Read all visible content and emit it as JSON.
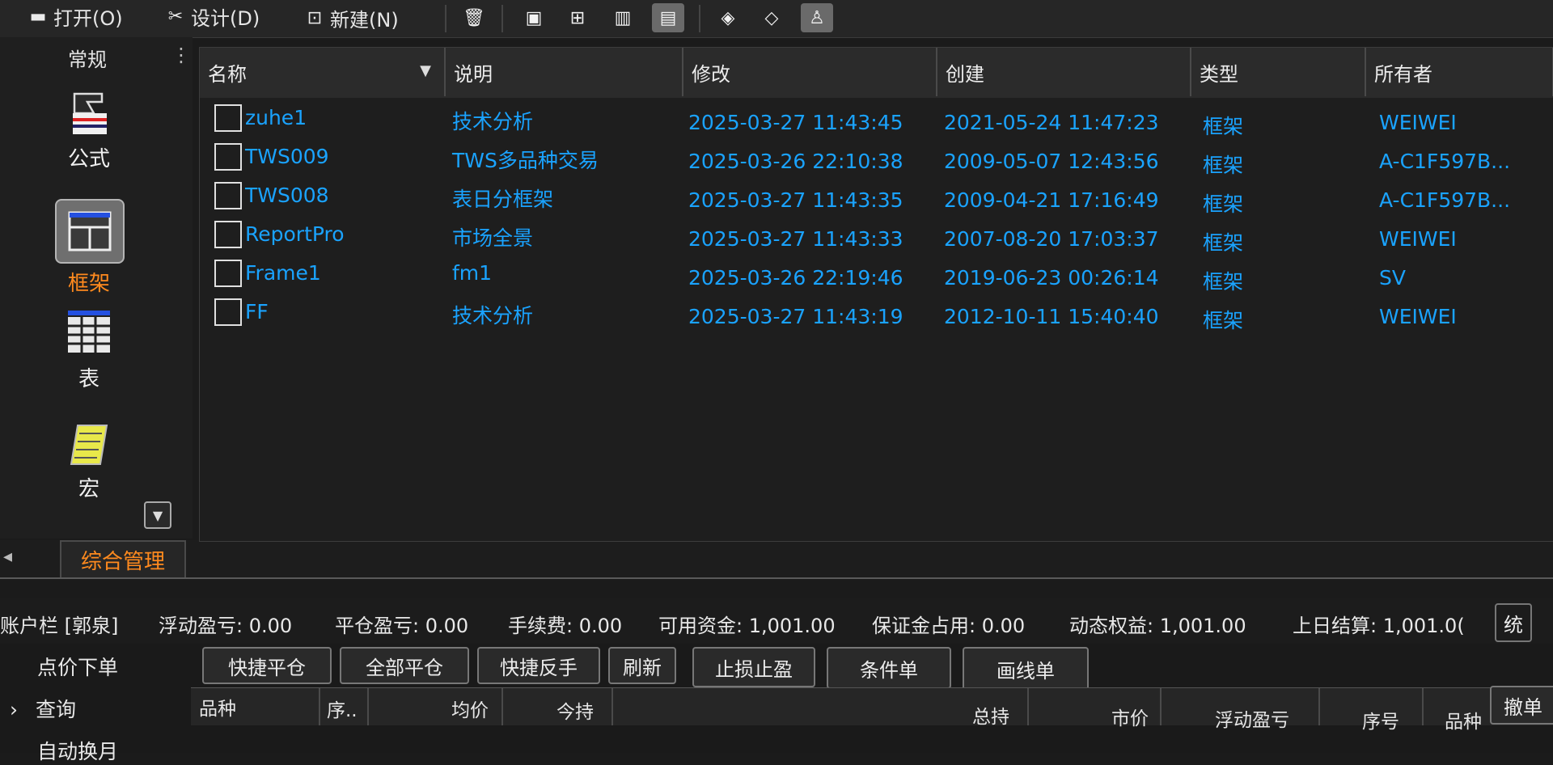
{
  "toolbar": {
    "open_label": "打开(O)",
    "design_label": "设计(D)",
    "new_label": "新建(N)"
  },
  "leftnav": {
    "title": "常规",
    "items": [
      {
        "label": "公式",
        "icon": "formula-icon"
      },
      {
        "label": "框架",
        "icon": "frame-icon",
        "selected": true
      },
      {
        "label": "表",
        "icon": "table-icon"
      },
      {
        "label": "宏",
        "icon": "macro-icon"
      }
    ]
  },
  "tabs": {
    "active": "综合管理"
  },
  "table": {
    "columns": [
      "名称",
      "说明",
      "修改",
      "创建",
      "类型",
      "所有者"
    ],
    "rows": [
      {
        "name": "zuhe1",
        "desc": "技术分析",
        "modified": "2025-03-27 11:43:45",
        "created": "2021-05-24 11:47:23",
        "type": "框架",
        "owner": "WEIWEI"
      },
      {
        "name": "TWS009",
        "desc": "TWS多品种交易",
        "modified": "2025-03-26 22:10:38",
        "created": "2009-05-07 12:43:56",
        "type": "框架",
        "owner": "A-C1F597B..."
      },
      {
        "name": "TWS008",
        "desc": "表日分框架",
        "modified": "2025-03-27 11:43:35",
        "created": "2009-04-21 17:16:49",
        "type": "框架",
        "owner": "A-C1F597B..."
      },
      {
        "name": "ReportPro",
        "desc": "市场全景",
        "modified": "2025-03-27 11:43:33",
        "created": "2007-08-20 17:03:37",
        "type": "框架",
        "owner": "WEIWEI"
      },
      {
        "name": "Frame1",
        "desc": "fm1",
        "modified": "2025-03-26 22:19:46",
        "created": "2019-06-23 00:26:14",
        "type": "框架",
        "owner": "SV"
      },
      {
        "name": "FF",
        "desc": "技术分析",
        "modified": "2025-03-27 11:43:19",
        "created": "2012-10-11 15:40:40",
        "type": "框架",
        "owner": "WEIWEI"
      }
    ]
  },
  "account": {
    "label": "账户栏 [郭泉]",
    "floating_pnl": "浮动盈亏: 0.00",
    "closed_pnl": "平仓盈亏: 0.00",
    "fee": "手续费: 0.00",
    "available": "可用资金: 1,001.00",
    "margin": "保证金占用: 0.00",
    "equity": "动态权益: 1,001.00",
    "prev_settle": "上日结算: 1,001.0(",
    "stat_btn": "统"
  },
  "bottom": {
    "nav": [
      "点价下单",
      "查询",
      "自动换月"
    ],
    "buttons": [
      "快捷平仓",
      "全部平仓",
      "快捷反手",
      "刷新",
      "止损止盈",
      "条件单",
      "画线单"
    ],
    "cancel": "撤单",
    "pos_headers": [
      "品种",
      "序..",
      "均价",
      "今持",
      "总持",
      "市价",
      "浮动盈亏",
      "序号",
      "品种"
    ]
  }
}
